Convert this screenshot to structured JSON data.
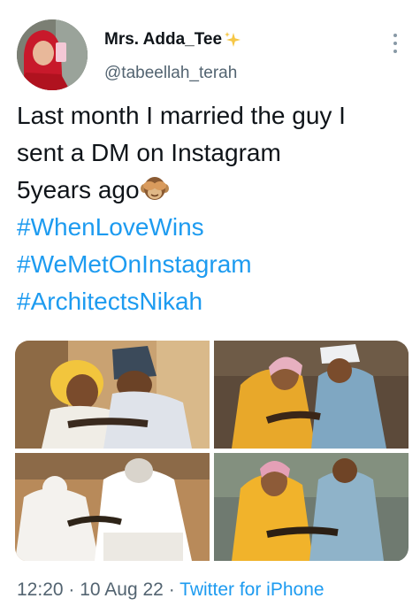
{
  "author": {
    "display_name": "Mrs. Adda_Tee",
    "handle": "@tabeellah_terah",
    "avatar_icon": "avatar-photo",
    "badge_icon": "sparkles-icon"
  },
  "more_icon": "more-options-icon",
  "tweet": {
    "line1": "Last month I married the guy I",
    "line2": "sent a DM on Instagram",
    "line3": "5years ago",
    "emoji": "see-no-evil-monkey",
    "hashtags": [
      "#WhenLoveWins",
      "#WeMetOnInstagram",
      "#ArchitectsNikah"
    ]
  },
  "media": {
    "count": 4,
    "photos": [
      "wedding-photo-1",
      "wedding-photo-2",
      "wedding-photo-3",
      "wedding-photo-4"
    ]
  },
  "meta": {
    "time": "12:20",
    "separator": "·",
    "date": "10 Aug 22",
    "source": "Twitter for iPhone"
  },
  "colors": {
    "link": "#1d9bf0",
    "secondary_text": "#536471",
    "primary_text": "#0f1419"
  }
}
